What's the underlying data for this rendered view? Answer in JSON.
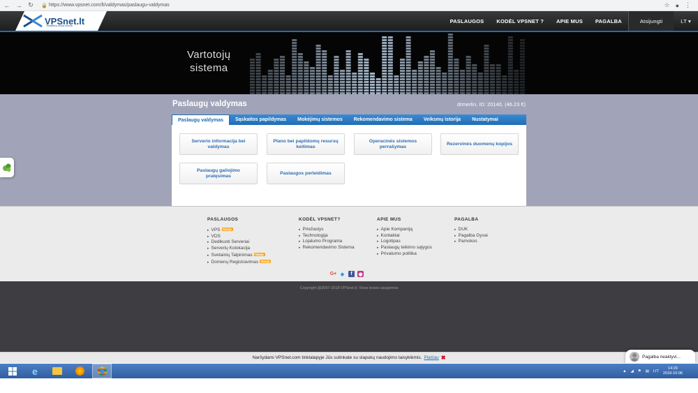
{
  "browser": {
    "url": "https://www.vpsnet.com/lt/valdymas/paslaugu-valdymas"
  },
  "header": {
    "logo_text": "VPSnet.lt",
    "logo_sub": "Tarnybinių stočių nuoma",
    "nav": [
      "PASLAUGOS",
      "KODĖL VPSNET ?",
      "APIE MUS",
      "PAGALBA"
    ],
    "logout": "Atsijungti",
    "lang": "LT ▾"
  },
  "banner": {
    "line1": "Vartotojų",
    "line2": "sistema"
  },
  "main": {
    "title": "Paslaugų valdymas",
    "user_info": "drmerlin, ID: 20140, (46.23 €)",
    "tabs": [
      "Paslaugų valdymas",
      "Sąskaitos papildymas",
      "Mokėjimų sistemos",
      "Rekomendavimo sistema",
      "Veiksmų istorija",
      "Nustatymai"
    ],
    "services": [
      "Serverio informacija bei valdymas",
      "Plano bei papildomų resursų keitimas",
      "Operacinės sistemos perrašymas",
      "Rezervinės duomenų kopijos",
      "Paslaugų galiojimo pratęsimas",
      "Paslaugos perleidimas"
    ]
  },
  "footer": {
    "col1_title": "PASLAUGOS",
    "col1_items": [
      "VPS",
      "VDS",
      "Dedikuoti Serveriai",
      "Serverių Kolokacija",
      "Svetainių Talpinimas",
      "Domenų Registravimas"
    ],
    "new_label": "Nauja",
    "col2_title": "KODĖL VPSNET?",
    "col2_items": [
      "Priežastys",
      "Technologija",
      "Lojalumo Programa",
      "Rekomendavimo Sistema"
    ],
    "col3_title": "APIE MUS",
    "col3_items": [
      "Apie Kompaniją",
      "Kontaktai",
      "Logotipas",
      "Paslaugų teikimo sąlygos",
      "Privatumo politika"
    ],
    "col4_title": "PAGALBA",
    "col4_items": [
      "DUK",
      "Pagalba Gyvai",
      "Pamokos"
    ],
    "copyright": "Copyright @2007-2018 VPSnet.lt. Visos teisės saugomos"
  },
  "cookie": {
    "text": "Naršydami VPSnet.com tinklalapyje Jūs sutinkate su slapukų naudojimo taisyklėmis.",
    "more": "Plačiau",
    "close": "✖"
  },
  "chat": {
    "label": "Pagalba neaktyvi..."
  },
  "taskbar": {
    "lang": "LIT",
    "time": "14:29",
    "date": "2018-10-06"
  },
  "colors": {
    "accent_blue": "#1f6db4",
    "page_bg": "#a1a3b8",
    "header_dark": "#1e1e1e"
  }
}
